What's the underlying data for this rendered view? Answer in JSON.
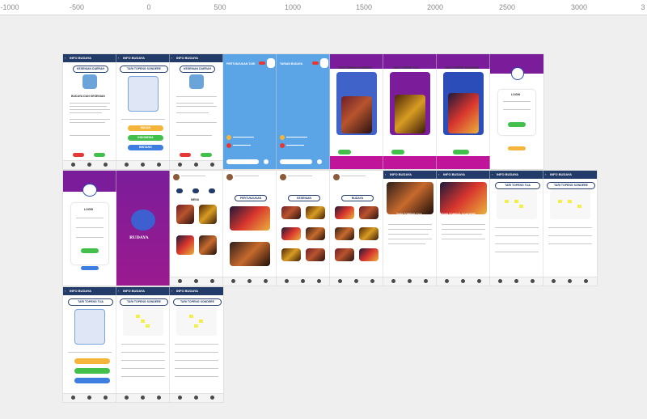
{
  "ruler": {
    "ticks": [
      "-1000",
      "-500",
      "0",
      "500",
      "1000",
      "1500",
      "2000",
      "2500",
      "3000",
      "3"
    ]
  },
  "colors": {
    "header": "#233b69",
    "purple": "#7b1d9a",
    "sky": "#5ba4e6",
    "pill_red": "#e53935",
    "pill_green": "#43c04b",
    "pill_orange": "#f5b53b",
    "pill_blue": "#3d7ee0"
  },
  "icons": [
    "back-arrow-icon",
    "home-icon",
    "search-icon",
    "settings-icon",
    "logo-mask-icon"
  ],
  "screens": {
    "info_budaya_1": {
      "header": "INFO BUDAYA",
      "card_title": "KESENIAN DAERAH",
      "sub_title": "BUDAYA DAN KESENIAN"
    },
    "detail_tari": {
      "header": "INFO BUDAYA",
      "card_title": "TARI TOPENG SONDERE",
      "btn_yellow": "WAYAN",
      "btn_green": "INDONESIA",
      "btn_blue": "BINTANG"
    },
    "info_budaya_2": {
      "header": "INFO BUDAYA",
      "card_title": "KESENIAN DAERAH"
    },
    "live_1": {
      "title": "PERTUNJUKAN TARI"
    },
    "live_2": {
      "title": "TARIAN BUDAYA"
    },
    "onboard_1": {
      "title": "TARI TOPENG SONDERE"
    },
    "onboard_2": {
      "title": "TARI TOPENG TUA"
    },
    "onboard_3": {
      "title": "TARI TOPENG SONDERE"
    },
    "login_1": {
      "title": "LOGIN"
    },
    "login_2": {
      "title": "LOGIN"
    },
    "splash": {
      "brand": "RUDAYA"
    },
    "menu": {
      "title": "MENU"
    },
    "gallery_1": {
      "title": "PERTUNJUKAN"
    },
    "gallery_2": {
      "title": "KESENIAN"
    },
    "gallery_3": {
      "title": "BUDAYA"
    },
    "article_1": {
      "header": "INFO BUDAYA",
      "caption": "TARI TOPENG TUA"
    },
    "article_2": {
      "header": "INFO BUDAYA",
      "caption": "TARI TOPENG SONDERE"
    },
    "schedule_1": {
      "header": "INFO BUDAYA",
      "title": "TARI TOPENG TUA"
    },
    "schedule_2": {
      "header": "INFO BUDAYA",
      "title": "TARI TOPENG SONDERE"
    },
    "detail_tua": {
      "header": "INFO BUDAYA",
      "card_title": "TARI TOPENG TUA"
    },
    "schedule_3": {
      "header": "INFO BUDAYA",
      "title": "TARI TOPENG SONDERE"
    },
    "schedule_4": {
      "header": "INFO BUDAYA",
      "title": "TARI TOPENG SONDERE"
    }
  }
}
